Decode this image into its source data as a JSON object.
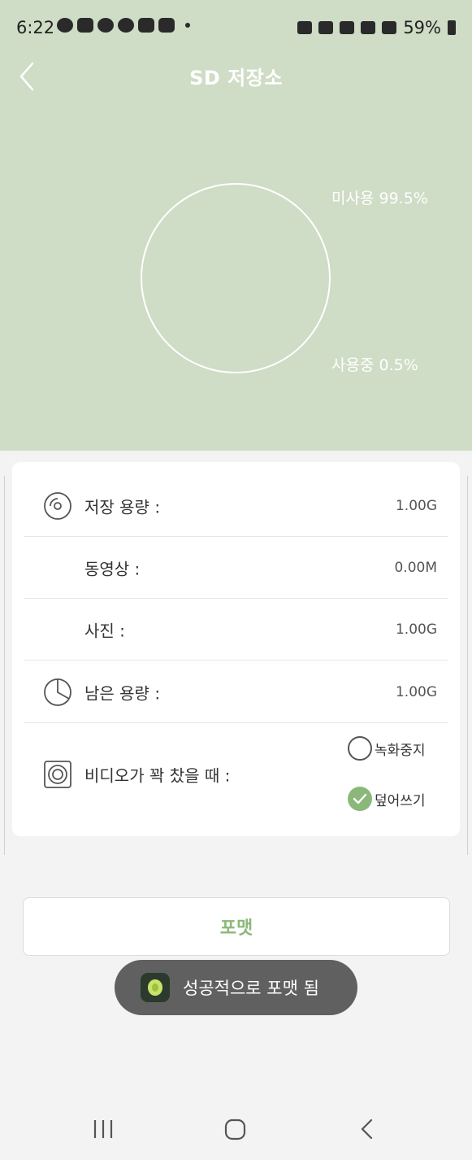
{
  "status_bar": {
    "time": "6:22",
    "battery": "59%",
    "left_icons": [
      "talk-icon",
      "youtube-icon",
      "app-icon",
      "shield-icon",
      "megaphone-icon",
      "mail-icon"
    ],
    "right_icons": [
      "key-icon",
      "alarm-icon",
      "mute-icon",
      "wifi-icon",
      "signal-icon"
    ]
  },
  "header": {
    "title": "SD 저장소",
    "back_icon": "chevron-left-icon",
    "background": "#cfdcc6"
  },
  "storage_chart": {
    "unused_label": "미사용 99.5%",
    "used_label": "사용중 0.5%",
    "unused_percent": 99.5,
    "used_percent": 0.5
  },
  "info": {
    "rows": [
      {
        "label": "저장 용량 :",
        "value": "1.00G",
        "icon": "disc-icon"
      },
      {
        "label": "동영상 :",
        "value": "0.00M"
      },
      {
        "label": "사진 :",
        "value": "1.00G"
      },
      {
        "label": "남은 용량 :",
        "value": "1.00G",
        "icon": "pie-chart-icon"
      }
    ],
    "full_label": "비디오가 꽉 찼을 때 :",
    "full_icon": "speaker-icon",
    "options": [
      {
        "label": "녹화중지",
        "checked": false
      },
      {
        "label": "덮어쓰기",
        "checked": true
      }
    ]
  },
  "format_button": "포맷",
  "toast": "성공적으로 포맷 됨",
  "colors": {
    "accent": "#8bb87a",
    "toast_bg": "#606060"
  },
  "nav_bar": [
    "recents-icon",
    "home-icon",
    "back-icon"
  ]
}
